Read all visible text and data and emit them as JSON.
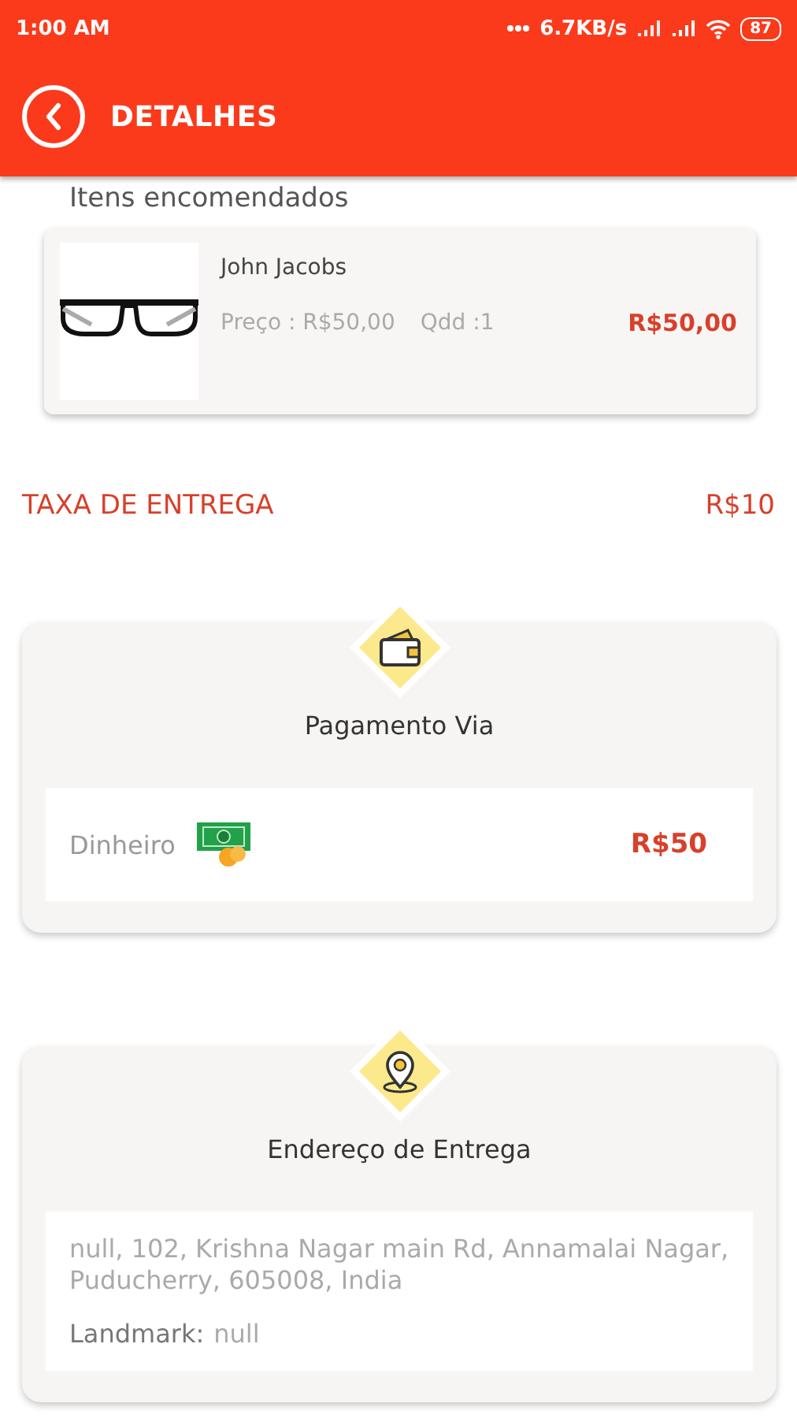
{
  "status_bar": {
    "time": "1:00 AM",
    "speed": "6.7KB/s",
    "battery": "87"
  },
  "header": {
    "title": "DETALHES"
  },
  "section_title": "Itens encomendados",
  "items": [
    {
      "kind": "picture",
      "name": "John Jacobs",
      "price": "Preço : R$50,00",
      "quantity": "Qdd :1",
      "total": "R$50,00"
    }
  ],
  "delivery_fee": {
    "label": "TAXA DE ENTREGA",
    "value": "R$10"
  },
  "payment": {
    "title": "Pagamento Via",
    "method": "Dinheiro",
    "amount": "R$50"
  },
  "address": {
    "title": "Endereço de Entrega",
    "text": "null, 102, Krishna Nagar main Rd, Annamalai Nagar, Puducherry, 605008, India",
    "landmark_label": "Landmark:",
    "landmark_value": "null"
  }
}
